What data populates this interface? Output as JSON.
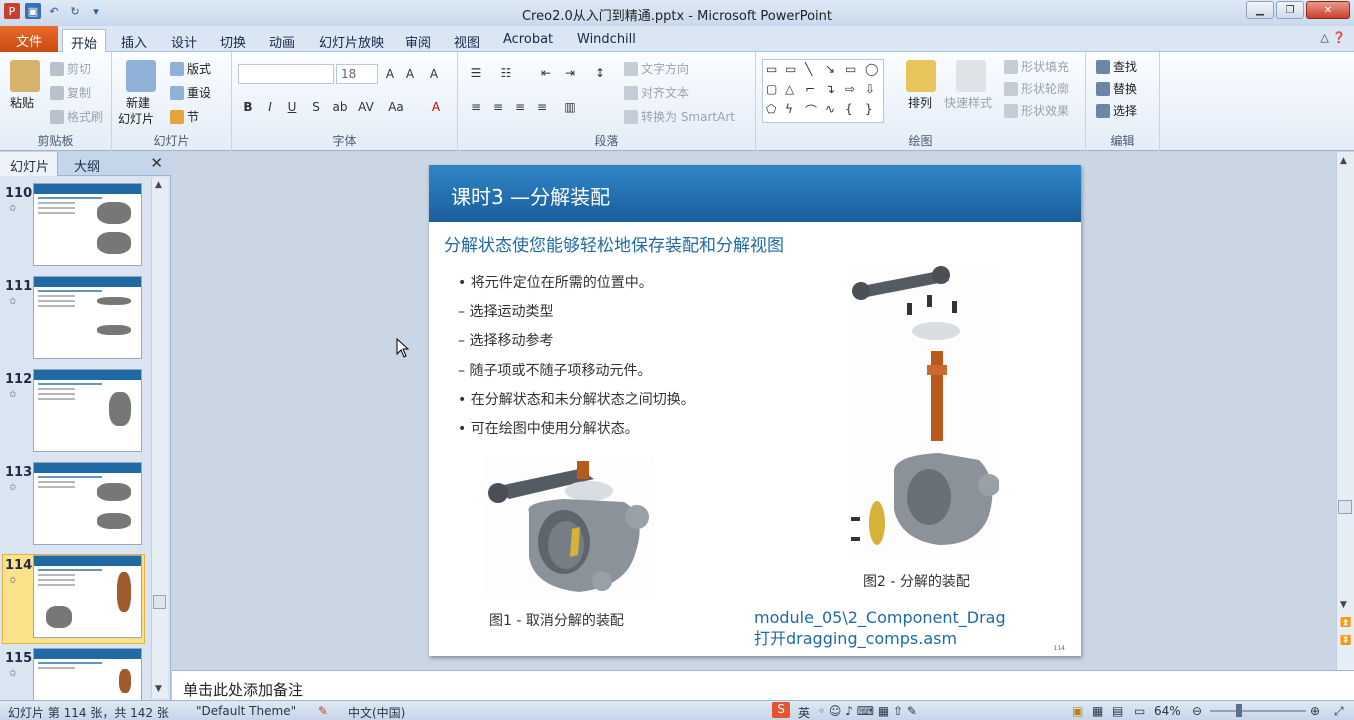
{
  "window": {
    "title": "Creo2.0从入门到精通.pptx - Microsoft PowerPoint"
  },
  "menu_tabs": [
    "文件",
    "开始",
    "插入",
    "设计",
    "切换",
    "动画",
    "幻灯片放映",
    "审阅",
    "视图",
    "Acrobat",
    "Windchill"
  ],
  "active_tab": "开始",
  "ribbon": {
    "clipboard": {
      "paste": "粘贴",
      "cut": "剪切",
      "copy": "复制",
      "format_painter": "格式刷",
      "label": "剪贴板"
    },
    "slides": {
      "new_slide_line1": "新建",
      "new_slide_line2": "幻灯片",
      "layout": "版式",
      "reset": "重设",
      "section": "节",
      "label": "幻灯片"
    },
    "font": {
      "font_size": "18",
      "label": "字体"
    },
    "paragraph": {
      "text_direction": "文字方向",
      "align_text": "对齐文本",
      "smartart": "转换为 SmartArt",
      "label": "段落"
    },
    "drawing": {
      "arrange": "排列",
      "quick_styles": "快速样式",
      "shape_fill": "形状填充",
      "shape_outline": "形状轮廓",
      "shape_effects": "形状效果",
      "label": "绘图"
    },
    "editing": {
      "find": "查找",
      "replace": "替换",
      "select": "选择",
      "label": "编辑"
    }
  },
  "slide_panel": {
    "tabs": [
      "幻灯片",
      "大纲"
    ],
    "thumbnails": [
      {
        "num": "110"
      },
      {
        "num": "111"
      },
      {
        "num": "112"
      },
      {
        "num": "113"
      },
      {
        "num": "114"
      },
      {
        "num": "115"
      }
    ],
    "selected": "114"
  },
  "slide": {
    "title": "课时3 —分解装配",
    "subtitle": "分解状态使您能够轻松地保存装配和分解视图",
    "bullets": [
      "• 将元件定位在所需的位置中。",
      "– 选择运动类型",
      "– 选择移动参考",
      "– 随子项或不随子项移动元件。",
      "• 在分解状态和未分解状态之间切换。",
      "• 可在绘图中使用分解状态。"
    ],
    "figure1_caption": "图1 - 取消分解的装配",
    "figure2_caption": "图2 - 分解的装配",
    "module_path_line1": "module_05\\2_Component_Drag",
    "module_path_line2": "打开dragging_comps.asm",
    "page_number": "114"
  },
  "notes": {
    "placeholder": "单击此处添加备注"
  },
  "status": {
    "slide_info": "幻灯片 第 114 张，共 142 张",
    "theme": "\"Default Theme\"",
    "language": "中文(中国)",
    "ime": "英",
    "zoom": "64%"
  }
}
